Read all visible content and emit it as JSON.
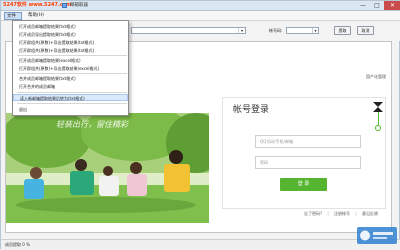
{
  "app": {
    "watermark": "5247软件 www.5247.com",
    "title": "邮箱取器"
  },
  "window": {
    "minimize": "—",
    "maximize": "□",
    "close": "✕"
  },
  "menubar": {
    "file": "文件(F)",
    "help": "帮助(H)"
  },
  "toolbar": {
    "url_value": "",
    "account_label": "帐号码:",
    "account_value": "",
    "extract_label": "提取",
    "cancel_label": "取消"
  },
  "file_menu": {
    "items": [
      "打开成员邮箱提取结果(txt格式)",
      "打开成员导出提取结果(txt格式)",
      "打开群组共(原数)+导出提取结果(txt格式)",
      "打开群组共(原数)+导出提取结果(txt格式)",
      "打开成员邮箱提取结果(excel格式)",
      "打开群组共(原数)+导出提取结果(excel格式)",
      "合并成员邮箱提取结果(txt格式)",
      "打开合并的成员邮箱",
      "读入新邮箱提取结果后转为(txt格式)",
      "退出"
    ]
  },
  "browser": {
    "top_link": "国产化管理",
    "hero_tagline": "轻装出行，留住精彩",
    "login": {
      "title": "帐号登录",
      "username_placeholder": "QQ号码/手机/邮箱",
      "password_placeholder": "密码",
      "login_button": "登 录",
      "links": [
        "忘了密码?",
        "注册帐号",
        "意见反馈"
      ],
      "separator": "|"
    }
  },
  "status": {
    "text": "成员提取 0 %"
  },
  "colors": {
    "accent_green": "#56b530",
    "title_bg": "#dbe6f3",
    "close_red": "#c94b4b",
    "watermark": "#ff3b00"
  }
}
